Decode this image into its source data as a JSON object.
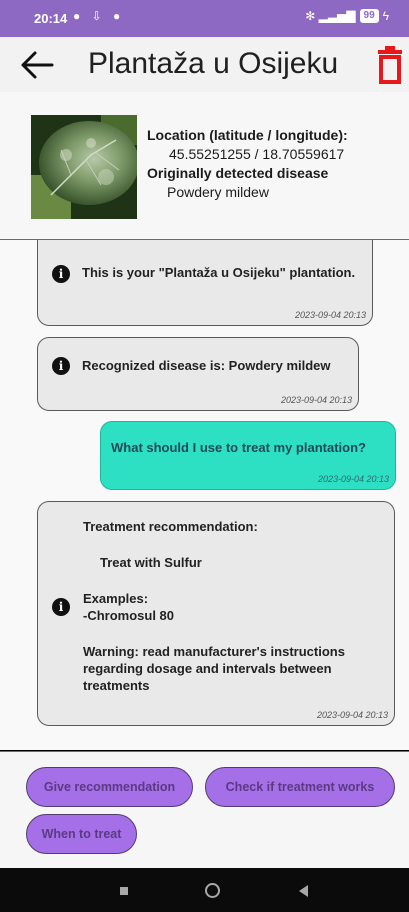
{
  "status_bar": {
    "time": "20:14",
    "left_icons": "● ⇩ ●",
    "right_icons": "✻ ▂▃▅▇",
    "battery": "99"
  },
  "app_bar": {
    "title": "Plantaža u Osijeku",
    "back_icon": "back-arrow-icon",
    "delete_icon": "trash-icon",
    "delete_color": "#e8171b"
  },
  "plantation_info": {
    "location_label": "Location (latitude / longitude):",
    "location_value": "45.55251255 / 18.70559617",
    "disease_label": "Originally detected disease",
    "disease_value": "Powdery mildew"
  },
  "messages": [
    {
      "sender": "bot",
      "text": "This is your \"Plantaža u Osijeku\" plantation.",
      "timestamp": "2023-09-04 20:13"
    },
    {
      "sender": "bot",
      "text": "Recognized disease is: Powdery mildew",
      "timestamp": "2023-09-04 20:13"
    },
    {
      "sender": "user",
      "text": "What should I use to treat my plantation?",
      "timestamp": "2023-09-04 20:13"
    },
    {
      "sender": "bot",
      "lines": [
        "Treatment recommendation:",
        "Treat with Sulfur",
        "Examples:",
        "-Chromosul 80",
        "Warning: read manufacturer's instructions regarding dosage and intervals between treatments"
      ],
      "timestamp": "2023-09-04 20:13"
    }
  ],
  "actions": {
    "give_recommendation": "Give recommendation",
    "check_treatment": "Check if treatment works",
    "when_to_treat": "When to treat"
  },
  "colors": {
    "status_bar": "#8d69c4",
    "user_bubble": "#2ee0c3",
    "action_button": "#a56fe8"
  }
}
